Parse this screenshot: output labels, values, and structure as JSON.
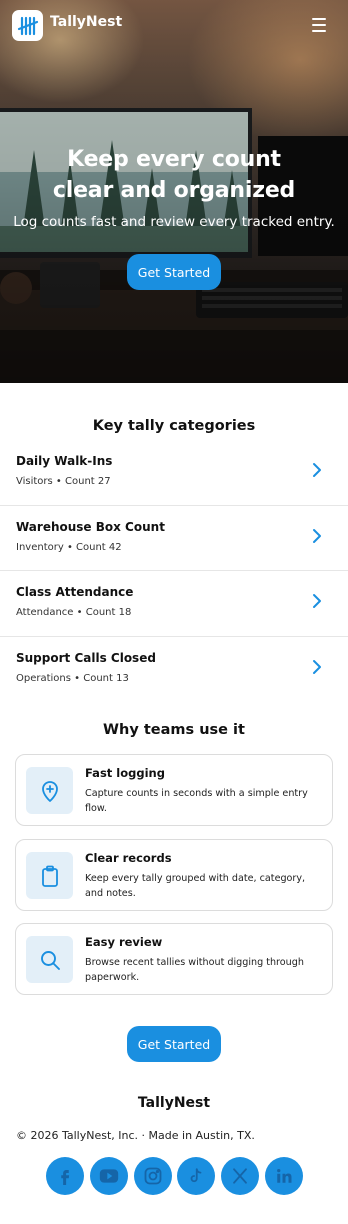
{
  "header": {
    "brand": "TallyNest",
    "logo_icon": "tally-marks-icon",
    "menu_icon": "hamburger-menu-icon"
  },
  "hero": {
    "title_line1": "Keep every count",
    "title_line2": "clear and organized",
    "subtitle": "Log counts fast and review every tracked entry.",
    "cta_label": "Get Started"
  },
  "categories": {
    "heading": "Key tally categories",
    "items": [
      {
        "title": "Daily Walk-Ins",
        "meta": "Visitors • Count 27"
      },
      {
        "title": "Warehouse Box Count",
        "meta": "Inventory • Count 42"
      },
      {
        "title": "Class Attendance",
        "meta": "Attendance • Count 18"
      },
      {
        "title": "Support Calls Closed",
        "meta": "Operations • Count 13"
      }
    ]
  },
  "features": {
    "heading": "Why teams use it",
    "items": [
      {
        "title": "Fast logging",
        "desc": "Capture counts in seconds with a simple entry flow.",
        "icon": "location-plus-icon"
      },
      {
        "title": "Clear records",
        "desc": "Keep every tally grouped with date, category, and notes.",
        "icon": "clipboard-icon"
      },
      {
        "title": "Easy review",
        "desc": "Browse recent tallies without digging through paperwork.",
        "icon": "search-icon"
      }
    ]
  },
  "cta": {
    "label": "Get Started"
  },
  "footer": {
    "brand": "TallyNest",
    "copyright": "© 2026 TallyNest, Inc. · Made in Austin, TX.",
    "socials": [
      "facebook-icon",
      "youtube-icon",
      "instagram-icon",
      "tiktok-icon",
      "x-icon",
      "linkedin-icon"
    ]
  },
  "colors": {
    "accent": "#1a8fe0",
    "icon_tile": "#e3eff8",
    "social_glyph": "#1565a8"
  }
}
